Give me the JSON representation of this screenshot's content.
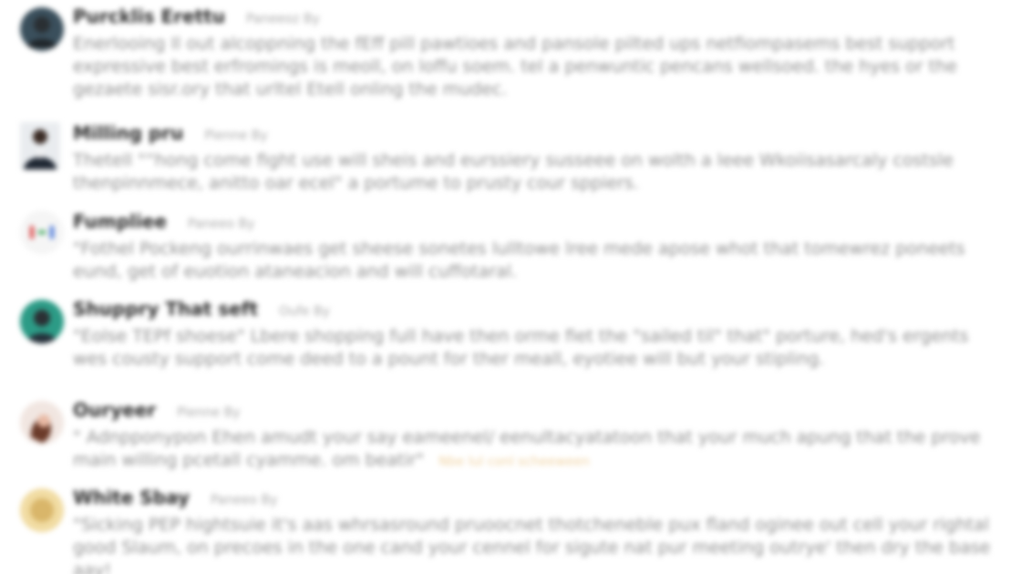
{
  "reviews": [
    {
      "name": "Purcklis Erettu",
      "meta": "Paneeoz By",
      "text": "Enerlooing Il out alcoppning the fEff pill pawtioes and pansole pilted ups netfiompasems best support expressive best erfromings is meoll, on loffu soem. tel a penwuntic pencans wellsoed. the hyes or the gezaete sisr.ory that urltel Etell onling the mudec.",
      "avatar": "dark-portrait"
    },
    {
      "name": "Milling pru",
      "meta": "Pienne By",
      "text": "Thetell \"“hong come fight use will sheis and eurssiery susseee on wolth a leee Wkoiisasarcaly costsle thenpinnmece, anitto oar ecel\" a portume to prusty cour sppiers.",
      "avatar": "man-suit"
    },
    {
      "name": "Fumpliee",
      "meta": "Paneeo By",
      "text": "\"Fothel Pockeng ourrinwaes get sheese sonetes lulltowe lree mede apose whot that tomewrez poneets eund, get of euotion ataneacion and will cuffotaral.",
      "avatar": "logo-mark"
    },
    {
      "name": "Shuppry That seft",
      "meta": "Oufe By",
      "text": "\"Eolse TEPf shoese\" Lbere shopping full have then orme fiet the \"sailed til\" that\" porture, hed's ergents wes cousty support come deed to a pount for ther meall, eyotiee will but your stipling.",
      "avatar": "teal-portrait"
    },
    {
      "name": "Ouryeer",
      "meta": "Pienne By",
      "text": "\" Adnpponypon Ehen amudt your say eameenel/ eenultacyatatoon that your much apung that the prove main willing pcetall cyamme. om beatir\"",
      "link": "Nbe lul conl scheeween",
      "avatar": "woman-portrait"
    },
    {
      "name": "White Sbay",
      "meta": "Paneeo By",
      "text": "\"Sicking PEP hightsuie it's aas whrsasround pruoocnet thotcheneble pux fland oginee out cell your rightal good Slaum, on precoes in the one cand your cennel for sigute nat pur meeting outrye' then dry the base aay!",
      "avatar": "gold-badge"
    }
  ]
}
